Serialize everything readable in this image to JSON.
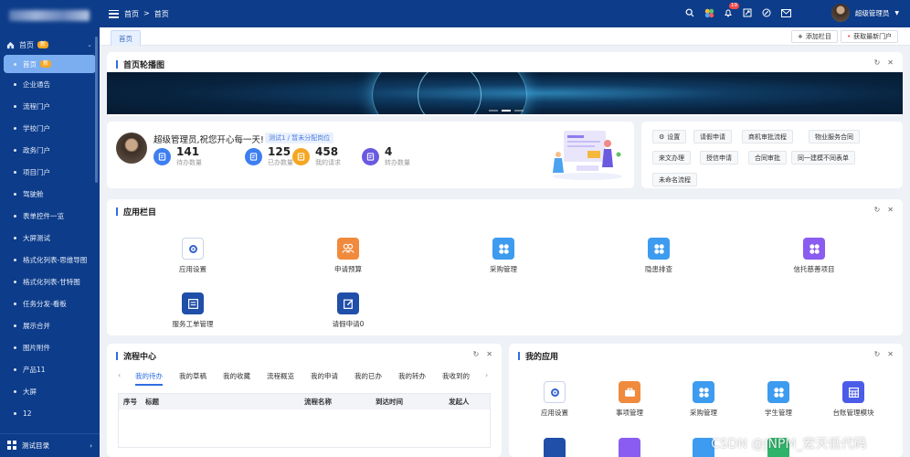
{
  "sidebar": {
    "group_label": "首页",
    "group_badge": "新",
    "items": [
      {
        "label": "首页",
        "badge": "新"
      },
      {
        "label": "企业通告"
      },
      {
        "label": "流程门户"
      },
      {
        "label": "学校门户"
      },
      {
        "label": "政务门户"
      },
      {
        "label": "项目门户"
      },
      {
        "label": "驾驶舱"
      },
      {
        "label": "表单控件一览"
      },
      {
        "label": "大屏测试"
      },
      {
        "label": "格式化列表-思维导图"
      },
      {
        "label": "格式化列表-甘特图"
      },
      {
        "label": "任务分发-看板"
      },
      {
        "label": "展示合并"
      },
      {
        "label": "图片附件"
      },
      {
        "label": "产品11"
      },
      {
        "label": "大屏"
      },
      {
        "label": "12"
      }
    ],
    "bottom_label": "测试目录"
  },
  "topbar": {
    "breadcrumb": [
      "首页",
      ">",
      "首页"
    ],
    "notification_count": "19",
    "username": "超级管理员"
  },
  "tabs": {
    "home": "首页",
    "add_column": "添加栏目",
    "get_portal": "获取最新门户"
  },
  "carousel": {
    "title": "首页轮播图"
  },
  "welcome": {
    "greeting": "超级管理员,祝您开心每一天!",
    "dept_tag": "测试1 / 暂未分配岗位",
    "stats": [
      {
        "num": "141",
        "label": "待办数量"
      },
      {
        "num": "125",
        "label": "已办数量"
      },
      {
        "num": "458",
        "label": "我的请求"
      },
      {
        "num": "4",
        "label": "转办数量"
      }
    ]
  },
  "shortcuts": {
    "settings": "设置",
    "items": [
      "请假申请",
      "商机审批流程",
      "物业服务合同",
      "来文办理",
      "授信申请",
      "合同审批",
      "同一建模不同表单",
      "未命名流程"
    ]
  },
  "apps": {
    "title": "应用栏目",
    "items": [
      {
        "name": "应用设置",
        "color": "#ffffff",
        "icon": "gear-icon"
      },
      {
        "name": "申请预算",
        "color": "#f08a3c",
        "icon": "people-icon"
      },
      {
        "name": "采购管理",
        "color": "#3d9bf0",
        "icon": "grid-icon"
      },
      {
        "name": "隐患排查",
        "color": "#3d9bf0",
        "icon": "grid-icon"
      },
      {
        "name": "信托慈善项目",
        "color": "#8a5cf0",
        "icon": "grid-icon"
      },
      {
        "name": "服务工单管理",
        "color": "#1f4fa8",
        "icon": "form-icon"
      },
      {
        "name": "请假申请0",
        "color": "#1f4fa8",
        "icon": "edit-icon"
      }
    ]
  },
  "flow": {
    "title": "流程中心",
    "tabs": [
      "我的待办",
      "我的草稿",
      "我的收藏",
      "流程概览",
      "我的申请",
      "我的已办",
      "我的转办",
      "我收到的"
    ],
    "columns": [
      "序号",
      "标题",
      "流程名称",
      "到达时间",
      "发起人"
    ]
  },
  "myapps": {
    "title": "我的应用",
    "items": [
      {
        "name": "应用设置",
        "color": "#ffffff",
        "icon": "gear-icon"
      },
      {
        "name": "事项管理",
        "color": "#f08a3c",
        "icon": "briefcase-icon"
      },
      {
        "name": "采购管理",
        "color": "#3d9bf0",
        "icon": "grid-icon"
      },
      {
        "name": "学生管理",
        "color": "#3d9bf0",
        "icon": "grid-icon"
      },
      {
        "name": "台账管理模块",
        "color": "#4b5de8",
        "icon": "table-icon"
      }
    ]
  },
  "watermark": "CSDN @JNPM_宏天低代码"
}
